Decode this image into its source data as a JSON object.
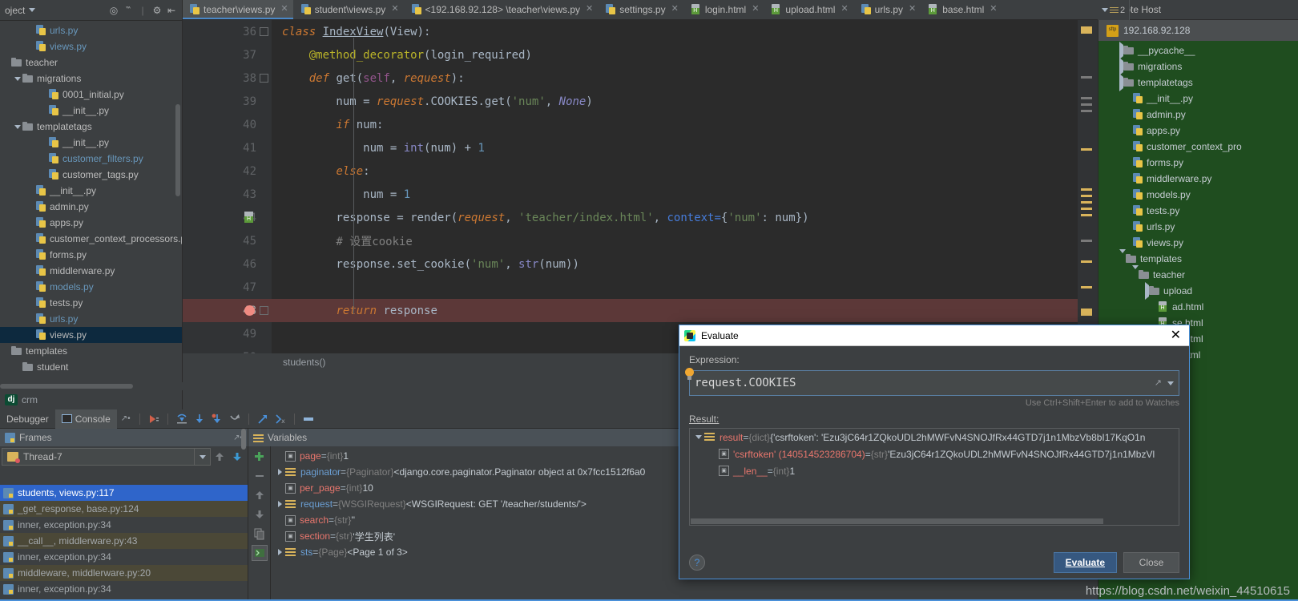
{
  "project": {
    "title": "oject",
    "header_icons": [
      "target-icon",
      "collapse-icon",
      "settings-icon",
      "hide-icon"
    ],
    "items": [
      {
        "label": "urls.py",
        "icon": "python-file-icon",
        "indent": 2,
        "arrow": "none",
        "color": "blue",
        "selected": false
      },
      {
        "label": "views.py",
        "icon": "python-file-icon",
        "indent": 2,
        "arrow": "none",
        "color": "blue",
        "selected": false
      },
      {
        "label": "teacher",
        "icon": "folder-icon",
        "indent": 0,
        "arrow": "none",
        "color": "plain",
        "selected": false
      },
      {
        "label": "migrations",
        "icon": "folder-icon",
        "indent": 1,
        "arrow": "down",
        "color": "plain",
        "selected": false
      },
      {
        "label": "0001_initial.py",
        "icon": "python-file-icon",
        "indent": 3,
        "arrow": "none",
        "color": "plain",
        "selected": false
      },
      {
        "label": "__init__.py",
        "icon": "python-file-icon",
        "indent": 3,
        "arrow": "none",
        "color": "plain",
        "selected": false
      },
      {
        "label": "templatetags",
        "icon": "folder-icon",
        "indent": 1,
        "arrow": "down",
        "color": "plain",
        "selected": false
      },
      {
        "label": "__init__.py",
        "icon": "python-file-icon",
        "indent": 3,
        "arrow": "none",
        "color": "plain",
        "selected": false
      },
      {
        "label": "customer_filters.py",
        "icon": "python-file-icon",
        "indent": 3,
        "arrow": "none",
        "color": "blue",
        "selected": false
      },
      {
        "label": "customer_tags.py",
        "icon": "python-file-icon",
        "indent": 3,
        "arrow": "none",
        "color": "plain",
        "selected": false
      },
      {
        "label": "__init__.py",
        "icon": "python-file-icon",
        "indent": 2,
        "arrow": "none",
        "color": "plain",
        "selected": false
      },
      {
        "label": "admin.py",
        "icon": "python-file-icon",
        "indent": 2,
        "arrow": "none",
        "color": "plain",
        "selected": false
      },
      {
        "label": "apps.py",
        "icon": "python-file-icon",
        "indent": 2,
        "arrow": "none",
        "color": "plain",
        "selected": false
      },
      {
        "label": "customer_context_processors.py",
        "icon": "python-file-icon",
        "indent": 2,
        "arrow": "none",
        "color": "plain",
        "selected": false
      },
      {
        "label": "forms.py",
        "icon": "python-file-icon",
        "indent": 2,
        "arrow": "none",
        "color": "plain",
        "selected": false
      },
      {
        "label": "middlerware.py",
        "icon": "python-file-icon",
        "indent": 2,
        "arrow": "none",
        "color": "plain",
        "selected": false
      },
      {
        "label": "models.py",
        "icon": "python-file-icon",
        "indent": 2,
        "arrow": "none",
        "color": "blue",
        "selected": false
      },
      {
        "label": "tests.py",
        "icon": "python-file-icon",
        "indent": 2,
        "arrow": "none",
        "color": "plain",
        "selected": false
      },
      {
        "label": "urls.py",
        "icon": "python-file-icon",
        "indent": 2,
        "arrow": "none",
        "color": "blue",
        "selected": false
      },
      {
        "label": "views.py",
        "icon": "python-file-icon",
        "indent": 2,
        "arrow": "none",
        "color": "plain",
        "selected": true
      },
      {
        "label": "templates",
        "icon": "folder-icon",
        "indent": 0,
        "arrow": "none",
        "color": "plain",
        "selected": false
      },
      {
        "label": "student",
        "icon": "folder-icon",
        "indent": 1,
        "arrow": "none",
        "color": "plain",
        "selected": false
      }
    ]
  },
  "django_status": {
    "badge": "dj",
    "label": "crm"
  },
  "tabs": [
    {
      "label": "teacher\\views.py",
      "icon": "python-file-icon",
      "active": true
    },
    {
      "label": "student\\views.py",
      "icon": "python-file-icon",
      "active": false
    },
    {
      "label": "<192.168.92.128> \\teacher\\views.py",
      "icon": "python-file-icon",
      "active": false
    },
    {
      "label": "settings.py",
      "icon": "python-file-icon",
      "active": false
    },
    {
      "label": "login.html",
      "icon": "html-file-icon",
      "active": false
    },
    {
      "label": "upload.html",
      "icon": "html-file-icon",
      "active": false
    },
    {
      "label": "urls.py",
      "icon": "python-file-icon",
      "active": false
    },
    {
      "label": "base.html",
      "icon": "html-file-icon",
      "active": false
    }
  ],
  "editor": {
    "status_text": "students()",
    "lines": [
      {
        "num": "36",
        "marker": "fold-class",
        "breakpoint": false,
        "tokens": [
          {
            "t": "class ",
            "c": "kw"
          },
          {
            "t": "IndexView",
            "c": "clsname"
          },
          {
            "t": "(",
            "c": "plain"
          },
          {
            "t": "View",
            "c": "plain"
          },
          {
            "t": "):",
            "c": "plain"
          }
        ]
      },
      {
        "num": "37",
        "marker": "",
        "breakpoint": false,
        "tokens": [
          {
            "t": "    ",
            "c": "plain"
          },
          {
            "t": "@method_decorator",
            "c": "deco"
          },
          {
            "t": "(login_required)",
            "c": "plain"
          }
        ]
      },
      {
        "num": "38",
        "marker": "fold-def",
        "breakpoint": false,
        "tokens": [
          {
            "t": "    ",
            "c": "plain"
          },
          {
            "t": "def ",
            "c": "kw"
          },
          {
            "t": "get",
            "c": "cls"
          },
          {
            "t": "(",
            "c": "plain"
          },
          {
            "t": "self",
            "c": "param"
          },
          {
            "t": ", ",
            "c": "plain"
          },
          {
            "t": "request",
            "c": "italic-o"
          },
          {
            "t": "):",
            "c": "plain"
          }
        ]
      },
      {
        "num": "39",
        "marker": "",
        "breakpoint": false,
        "tokens": [
          {
            "t": "        num ",
            "c": "plain"
          },
          {
            "t": "= ",
            "c": "plain"
          },
          {
            "t": "request",
            "c": "italic-o"
          },
          {
            "t": ".COOKIES.",
            "c": "plain"
          },
          {
            "t": "get",
            "c": "cls"
          },
          {
            "t": "(",
            "c": "plain"
          },
          {
            "t": "'num'",
            "c": "str"
          },
          {
            "t": ", ",
            "c": "plain"
          },
          {
            "t": "None",
            "c": "kwpy"
          },
          {
            "t": ")",
            "c": "plain"
          }
        ]
      },
      {
        "num": "40",
        "marker": "",
        "breakpoint": false,
        "tokens": [
          {
            "t": "        ",
            "c": "plain"
          },
          {
            "t": "if ",
            "c": "kw"
          },
          {
            "t": "num:",
            "c": "plain"
          }
        ]
      },
      {
        "num": "41",
        "marker": "",
        "breakpoint": false,
        "tokens": [
          {
            "t": "            num ",
            "c": "plain"
          },
          {
            "t": "= ",
            "c": "plain"
          },
          {
            "t": "int",
            "c": "builtin"
          },
          {
            "t": "(num) ",
            "c": "plain"
          },
          {
            "t": "+ ",
            "c": "plain"
          },
          {
            "t": "1",
            "c": "num"
          }
        ]
      },
      {
        "num": "42",
        "marker": "",
        "breakpoint": false,
        "tokens": [
          {
            "t": "        ",
            "c": "plain"
          },
          {
            "t": "else",
            "c": "kw"
          },
          {
            "t": ":",
            "c": "plain"
          }
        ]
      },
      {
        "num": "43",
        "marker": "",
        "breakpoint": false,
        "tokens": [
          {
            "t": "            num ",
            "c": "plain"
          },
          {
            "t": "= ",
            "c": "plain"
          },
          {
            "t": "1",
            "c": "num"
          }
        ]
      },
      {
        "num": "44",
        "marker": "html",
        "breakpoint": false,
        "tokens": [
          {
            "t": "        response ",
            "c": "plain"
          },
          {
            "t": "= ",
            "c": "plain"
          },
          {
            "t": "render",
            "c": "cls"
          },
          {
            "t": "(",
            "c": "plain"
          },
          {
            "t": "request",
            "c": "italic-o"
          },
          {
            "t": ", ",
            "c": "plain"
          },
          {
            "t": "'teacher/index.html'",
            "c": "str"
          },
          {
            "t": ", ",
            "c": "plain"
          },
          {
            "t": "context=",
            "c": "namedarg"
          },
          {
            "t": "{",
            "c": "plain"
          },
          {
            "t": "'num'",
            "c": "str"
          },
          {
            "t": ": num})",
            "c": "plain"
          }
        ]
      },
      {
        "num": "45",
        "marker": "",
        "breakpoint": false,
        "tokens": [
          {
            "t": "        # 设置cookie",
            "c": "cmt"
          }
        ]
      },
      {
        "num": "46",
        "marker": "",
        "breakpoint": false,
        "tokens": [
          {
            "t": "        response.",
            "c": "plain"
          },
          {
            "t": "set_cookie",
            "c": "cls"
          },
          {
            "t": "(",
            "c": "plain"
          },
          {
            "t": "'num'",
            "c": "str"
          },
          {
            "t": ", ",
            "c": "plain"
          },
          {
            "t": "str",
            "c": "builtin"
          },
          {
            "t": "(num))",
            "c": "plain"
          }
        ]
      },
      {
        "num": "47",
        "marker": "",
        "breakpoint": false,
        "tokens": []
      },
      {
        "num": "48",
        "marker": "fold-end",
        "breakpoint": true,
        "tokens": [
          {
            "t": "        ",
            "c": "plain"
          },
          {
            "t": "return ",
            "c": "kw"
          },
          {
            "t": "response",
            "c": "plain"
          }
        ]
      },
      {
        "num": "49",
        "marker": "",
        "breakpoint": false,
        "tokens": []
      },
      {
        "num": "50",
        "marker": "",
        "breakpoint": false,
        "tokens": []
      }
    ]
  },
  "remote_host": {
    "title": "Remote Host",
    "tab_badge": "2",
    "root": "192.168.92.128",
    "items": [
      {
        "label": "__pycache__",
        "icon": "folder-icon",
        "indent": 1,
        "arrow": "right"
      },
      {
        "label": "migrations",
        "icon": "folder-icon",
        "indent": 1,
        "arrow": "right"
      },
      {
        "label": "templatetags",
        "icon": "folder-icon",
        "indent": 1,
        "arrow": "right"
      },
      {
        "label": "__init__.py",
        "icon": "python-file-icon",
        "indent": 2,
        "arrow": "none"
      },
      {
        "label": "admin.py",
        "icon": "python-file-icon",
        "indent": 2,
        "arrow": "none"
      },
      {
        "label": "apps.py",
        "icon": "python-file-icon",
        "indent": 2,
        "arrow": "none"
      },
      {
        "label": "customer_context_pro",
        "icon": "python-file-icon",
        "indent": 2,
        "arrow": "none"
      },
      {
        "label": "forms.py",
        "icon": "python-file-icon",
        "indent": 2,
        "arrow": "none"
      },
      {
        "label": "middlerware.py",
        "icon": "python-file-icon",
        "indent": 2,
        "arrow": "none"
      },
      {
        "label": "models.py",
        "icon": "python-file-icon",
        "indent": 2,
        "arrow": "none"
      },
      {
        "label": "tests.py",
        "icon": "python-file-icon",
        "indent": 2,
        "arrow": "none"
      },
      {
        "label": "urls.py",
        "icon": "python-file-icon",
        "indent": 2,
        "arrow": "none"
      },
      {
        "label": "views.py",
        "icon": "python-file-icon",
        "indent": 2,
        "arrow": "none"
      },
      {
        "label": "templates",
        "icon": "folder-icon",
        "indent": 1,
        "arrow": "down"
      },
      {
        "label": "teacher",
        "icon": "folder-icon",
        "indent": 2,
        "arrow": "down"
      },
      {
        "label": "upload",
        "icon": "folder-icon",
        "indent": 3,
        "arrow": "right"
      },
      {
        "label": "ad.html",
        "icon": "html-file-icon",
        "indent": 4,
        "arrow": "none"
      },
      {
        "label": "se.html",
        "icon": "html-file-icon",
        "indent": 4,
        "arrow": "none"
      },
      {
        "label": "ex.html",
        "icon": "html-file-icon",
        "indent": 4,
        "arrow": "none"
      },
      {
        "label": "in.html",
        "icon": "html-file-icon",
        "indent": 4,
        "arrow": "none"
      }
    ]
  },
  "debugger": {
    "tab_debugger": "Debugger",
    "tab_console": "Console",
    "toolbar_icons": [
      "resume-icon",
      "step-over-icon",
      "step-into-icon",
      "force-step-into-icon",
      "step-out-icon",
      "run-to-cursor-icon",
      "evaluate-expression-icon",
      "mute-breakpoints-icon"
    ],
    "frames": {
      "pane_title": "Frames",
      "thread": "Thread-7",
      "items": [
        {
          "label": "students, views.py:117",
          "selected": true
        },
        {
          "label": "_get_response, base.py:124",
          "selected": false
        },
        {
          "label": "inner, exception.py:34",
          "selected": false
        },
        {
          "label": "__call__, middlerware.py:43",
          "selected": false
        },
        {
          "label": "inner, exception.py:34",
          "selected": false
        },
        {
          "label": "middleware, middlerware.py:20",
          "selected": false
        },
        {
          "label": "inner, exception.py:34",
          "selected": false
        }
      ]
    },
    "variables": {
      "pane_title": "Variables",
      "items": [
        {
          "arrow": "none",
          "icon": "int-icon",
          "name": "page",
          "name_color": "red",
          "type": "{int}",
          "value": "1"
        },
        {
          "arrow": "right",
          "icon": "obj-icon",
          "name": "paginator",
          "name_color": "blue",
          "type": "{Paginator}",
          "value": "<django.core.paginator.Paginator object at 0x7fcc1512f6a0"
        },
        {
          "arrow": "none",
          "icon": "int-icon",
          "name": "per_page",
          "name_color": "red",
          "type": "{int}",
          "value": "10"
        },
        {
          "arrow": "right",
          "icon": "obj-icon",
          "name": "request",
          "name_color": "blue",
          "type": "{WSGIRequest}",
          "value": "<WSGIRequest: GET '/teacher/students/'>"
        },
        {
          "arrow": "none",
          "icon": "int-icon",
          "name": "search",
          "name_color": "red",
          "type": "{str}",
          "value": "''"
        },
        {
          "arrow": "none",
          "icon": "int-icon",
          "name": "section",
          "name_color": "red",
          "type": "{str}",
          "value": "'学生列表'"
        },
        {
          "arrow": "right",
          "icon": "obj-icon",
          "name": "sts",
          "name_color": "blue",
          "type": "{Page}",
          "value": "<Page 1 of 3>"
        }
      ]
    }
  },
  "evaluate_dialog": {
    "title": "Evaluate",
    "expression_label": "Expression:",
    "expression_value": "request.COOKIES",
    "hint": "Use Ctrl+Shift+Enter to add to Watches",
    "result_label": "Result:",
    "result_rows": [
      {
        "arrow": "down",
        "icon": "obj-icon",
        "name": "result",
        "name_color": "red",
        "type": "{dict}",
        "value": "{'csrftoken': 'Ezu3jC64r1ZQkoUDL2hMWFvN4SNOJfRx44GTD7j1n1MbzVb8bI17KqO1n",
        "indent": 0
      },
      {
        "arrow": "none",
        "icon": "str-icon",
        "name": "'csrftoken' (140514523286704)",
        "name_color": "red",
        "type": "{str}",
        "value": "'Ezu3jC64r1ZQkoUDL2hMWFvN4SNOJfRx44GTD7j1n1MbzVl",
        "indent": 1
      },
      {
        "arrow": "none",
        "icon": "int-icon",
        "name": "__len__",
        "name_color": "red",
        "type": "{int}",
        "value": "1",
        "indent": 1
      }
    ],
    "help_button": "?",
    "evaluate_button": "Evaluate",
    "close_button": "Close",
    "close_icon": "close-icon"
  },
  "watermark": "https://blog.csdn.net/weixin_44510615",
  "colors": {
    "accent": "#4a90d9",
    "selection": "#2f65ca",
    "breakpoint_line": "#5c3838",
    "remote_bg": "#1f4d1f",
    "editor_bg": "#2b2b2b",
    "panel_bg": "#3c3f41"
  }
}
